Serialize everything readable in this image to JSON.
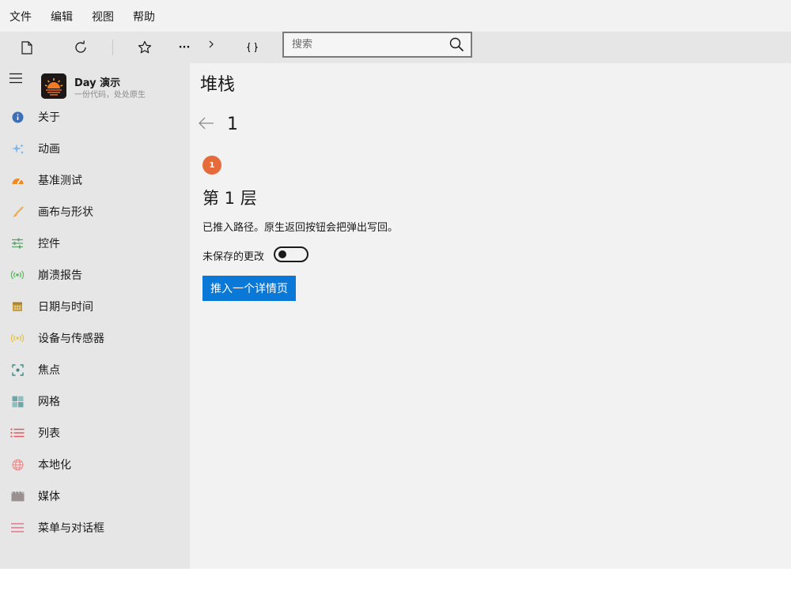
{
  "menubar": {
    "items": [
      "文件",
      "编辑",
      "视图",
      "帮助"
    ]
  },
  "toolbar": {
    "icons": [
      "new-page-icon",
      "refresh-icon",
      "star-icon",
      "more-icon",
      "chevron-right-icon",
      "braces-icon"
    ],
    "more_label": "···",
    "search": {
      "placeholder": "搜索",
      "value": ""
    }
  },
  "app": {
    "name": "Day 演示",
    "tagline": "一份代码，处处原生"
  },
  "sidebar": {
    "items": [
      {
        "label": "关于",
        "icon": "info-icon",
        "color": "#3d6fb6"
      },
      {
        "label": "动画",
        "icon": "sparkle-icon",
        "color": "#7fb7e8"
      },
      {
        "label": "基准测试",
        "icon": "speedometer-icon",
        "color": "#f08a24"
      },
      {
        "label": "画布与形状",
        "icon": "brush-icon",
        "color": "#f0a84a"
      },
      {
        "label": "控件",
        "icon": "sliders-icon",
        "color": "#5aa469"
      },
      {
        "label": "崩溃报告",
        "icon": "broadcast-icon",
        "color": "#5cb85c"
      },
      {
        "label": "日期与时间",
        "icon": "calendar-icon",
        "color": "#c8a040"
      },
      {
        "label": "设备与传感器",
        "icon": "sensor-icon",
        "color": "#e8c040"
      },
      {
        "label": "焦点",
        "icon": "focus-icon",
        "color": "#3a8a8a"
      },
      {
        "label": "网格",
        "icon": "grid-icon",
        "color": "#6aa8a8"
      },
      {
        "label": "列表",
        "icon": "list-icon",
        "color": "#e05a5a"
      },
      {
        "label": "本地化",
        "icon": "globe-icon",
        "color": "#e88a8a"
      },
      {
        "label": "媒体",
        "icon": "clapper-icon",
        "color": "#9a9090"
      },
      {
        "label": "菜单与对话框",
        "icon": "menu-icon",
        "color": "#e0607a"
      }
    ]
  },
  "main": {
    "title": "堆栈",
    "level": "1",
    "badge": "1",
    "layer_title": "第 1 层",
    "description": "已推入路径。原生返回按钮会把弹出写回。",
    "toggle": {
      "label": "未保存的更改",
      "on": false
    },
    "push_button": "推入一个详情页"
  },
  "colors": {
    "accent": "#0a78d7",
    "badge": "#e56b3a"
  }
}
